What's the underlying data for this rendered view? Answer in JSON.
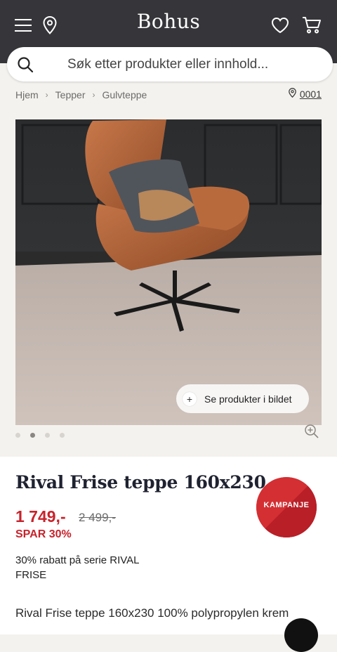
{
  "header": {
    "logo": "Bohus",
    "menu_icon": "hamburger-menu-icon",
    "location_icon": "map-pin-icon",
    "wishlist_icon": "heart-icon",
    "cart_icon": "shopping-cart-icon",
    "background": "#36363a"
  },
  "search": {
    "placeholder": "Søk etter produkter eller innhold...",
    "icon": "search-icon"
  },
  "breadcrumb": {
    "items": [
      "Hjem",
      "Tepper",
      "Gulvteppe"
    ],
    "store_code": "0001"
  },
  "gallery": {
    "see_products_label": "Se produkter i bildet",
    "slide_count": 4,
    "active_slide": 2
  },
  "product": {
    "title": "Rival Frise teppe 160x230",
    "price": "1 749,-",
    "old_price": "2 499,-",
    "save_label": "SPAR 30%",
    "campaign_text": "30% rabatt på serie RIVAL FRISE",
    "badge": "KAMPANJE",
    "description": "Rival Frise teppe 160x230 100% polypropylen krem",
    "accent_color": "#c8232c"
  }
}
